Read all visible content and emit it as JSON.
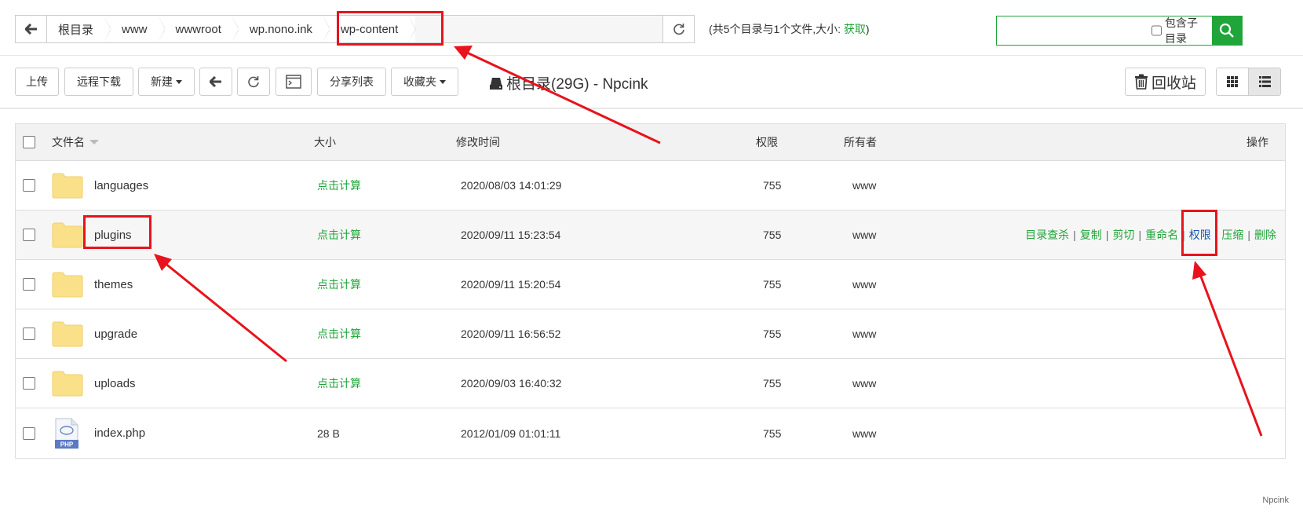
{
  "pathbar": {
    "crumbs": [
      "根目录",
      "www",
      "wwwroot",
      "wp.nono.ink",
      "wp-content"
    ]
  },
  "dir_info": {
    "text": "(共5个目录与1个文件,大小:",
    "link": "获取",
    "close": ")"
  },
  "search": {
    "placeholder": "",
    "subdir_label": "包含子目录"
  },
  "toolbar": {
    "upload": "上传",
    "remote_download": "远程下载",
    "new": "新建",
    "share_list": "分享列表",
    "favorites": "收藏夹",
    "disk": "根目录(29G) - Npcink",
    "recycle": "回收站"
  },
  "table": {
    "headers": {
      "name": "文件名",
      "size": "大小",
      "mtime": "修改时间",
      "perm": "权限",
      "owner": "所有者",
      "ops": "操作"
    },
    "rows": [
      {
        "name": "languages",
        "size": "点击计算",
        "mtime": "2020/08/03 14:01:29",
        "perm": "755",
        "owner": "www"
      },
      {
        "name": "plugins",
        "size": "点击计算",
        "mtime": "2020/09/11 15:23:54",
        "perm": "755",
        "owner": "www"
      },
      {
        "name": "themes",
        "size": "点击计算",
        "mtime": "2020/09/11 15:20:54",
        "perm": "755",
        "owner": "www"
      },
      {
        "name": "upgrade",
        "size": "点击计算",
        "mtime": "2020/09/11 16:56:52",
        "perm": "755",
        "owner": "www"
      },
      {
        "name": "uploads",
        "size": "点击计算",
        "mtime": "2020/09/03 16:40:32",
        "perm": "755",
        "owner": "www"
      },
      {
        "name": "index.php",
        "size": "28 B",
        "mtime": "2012/01/09 01:01:11",
        "perm": "755",
        "owner": "www"
      }
    ],
    "row_ops": [
      "目录查杀",
      "复制",
      "剪切",
      "重命名",
      "权限",
      "压缩",
      "删除"
    ]
  },
  "file_icon_label": "PHP",
  "watermark": "Npcink",
  "colors": {
    "accent": "#20a53a",
    "annotation": "#e8131c",
    "folder": "#fbe08a"
  }
}
